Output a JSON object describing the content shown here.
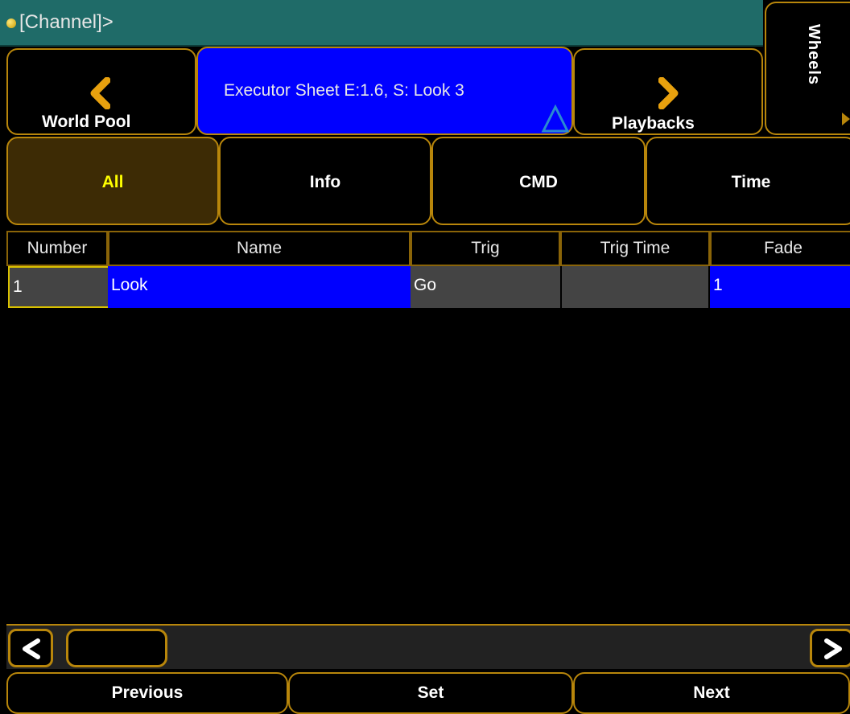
{
  "command_line": {
    "prompt": "[Channel]>"
  },
  "wheels_tab": {
    "label": "Wheels"
  },
  "title_bar": {
    "left_button": "World Pool",
    "center_title": "Executor Sheet E:1.6, S: Look 3",
    "right_button": "Playbacks"
  },
  "filter_tabs": {
    "all": "All",
    "info": "Info",
    "cmd": "CMD",
    "time": "Time",
    "selected": "All"
  },
  "table": {
    "headers": {
      "number": "Number",
      "name": "Name",
      "trig": "Trig",
      "trig_time": "Trig Time",
      "fade": "Fade"
    },
    "rows": [
      {
        "number": "1",
        "name": "Look",
        "trig": "Go",
        "trig_time": "",
        "fade": "1"
      }
    ]
  },
  "bottom_buttons": {
    "previous": "Previous",
    "set": "Set",
    "next": "Next"
  },
  "colors": {
    "accent_gold": "#b8860b",
    "selected_blue": "#0000ff",
    "cmdline_teal": "#1f6b68"
  },
  "icons": {
    "prev": "chevron-left-icon",
    "next": "chevron-right-icon",
    "scroll_left": "scroll-left-icon",
    "scroll_right": "scroll-right-icon"
  }
}
